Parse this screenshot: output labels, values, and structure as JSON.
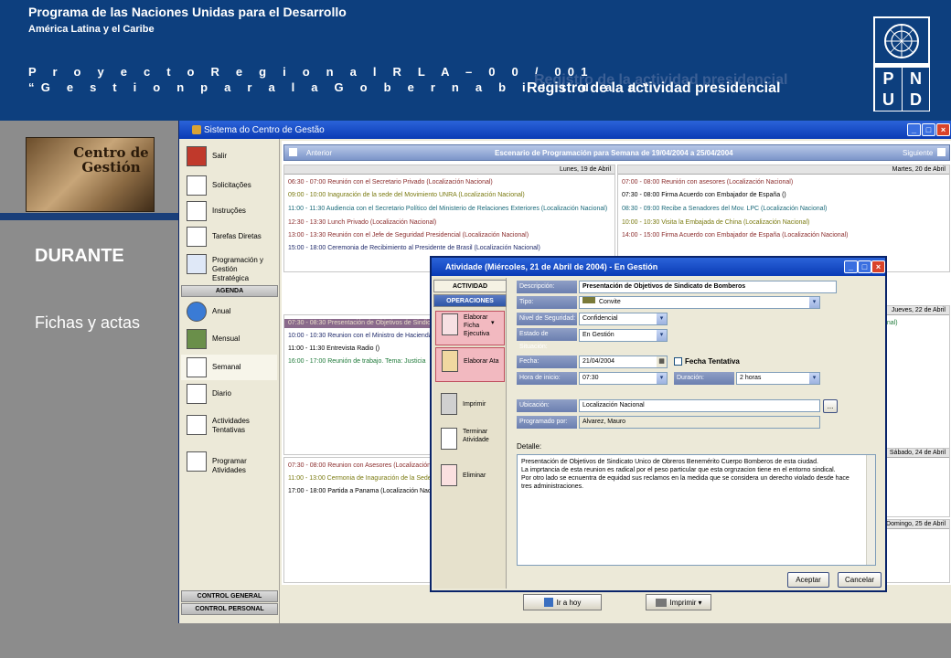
{
  "slide": {
    "org_title": "Programa de las  Naciones Unidas para el  Desarrollo",
    "org_subtitle": "América Latina y el Caribe",
    "project_line1": "P r o y e c t o   R e g i o n a l  R L A – 0 0 / 001",
    "project_line2": "“G e s t i o n   p a r a   l a   G o b e r n a b i l i d a d”",
    "title": "Registro de la actividad presidencial",
    "logo_letters": [
      "P",
      "N",
      "U",
      "D"
    ],
    "brand_image_text": "Centro de Gestión",
    "lead_word": "DURANTE",
    "lead_caption": "Fichas y actas"
  },
  "app": {
    "window_title": "Sistema do Centro de Gestão",
    "nav": {
      "items": [
        {
          "icon": "exit-door-icon",
          "label": "Salir"
        },
        {
          "icon": "clipboard-icon",
          "label": "Solicitações"
        },
        {
          "icon": "checklist-icon",
          "label": "Instruções"
        },
        {
          "icon": "notepad-icon",
          "label": "Tarefas Diretas"
        },
        {
          "icon": "strategy-screen-icon",
          "label": "Programación y Gestión Estratégica"
        }
      ],
      "agenda_header": "AGENDA",
      "agenda_items": [
        {
          "icon": "globe-icon",
          "label": "Anual"
        },
        {
          "icon": "monthly-book-icon",
          "label": "Mensual"
        },
        {
          "icon": "weekly-calendar-icon",
          "label": "Semanal"
        },
        {
          "icon": "daily-calendar-icon",
          "label": "Diario"
        },
        {
          "icon": "tentative-grid-icon",
          "label": "Actividades Tentativas"
        },
        {
          "icon": "schedule-grid-icon",
          "label": "Programar Atividades"
        }
      ],
      "footer_sections": [
        "CONTROL GENERAL",
        "CONTROL PERSONAL"
      ]
    },
    "calendar": {
      "prev_label": "Anterior",
      "next_label": "Siguiente",
      "week_title": "Escenario de Programación para Semana de 19/04/2004 a 25/04/2004",
      "monday": {
        "header": "Lunes, 19 de Abril",
        "events": [
          "06:30 - 07:00  Reunión con el Secretario Privado (Localización Nacional)",
          "09:00 - 10:00  Inaguración de la sede del  Movimiento UNRA (Localización Nacional)",
          "11:00 - 11:30  Audiencia con el Secretario Político del Ministerio de Relaciones Exteriores (Localización Nacional)",
          "12:30 - 13:30  Lunch Privado (Localización Nacional)",
          "13:00 - 13:30  Reunión con el Jefe de Seguridad Presidencial (Localización Nacional)",
          "15:00 - 18:00  Ceremonia de Recibimiento al Presidente de Brasil (Localización Nacional)"
        ]
      },
      "tuesday": {
        "header": "Martes, 20 de Abril",
        "events": [
          "07:00 - 08:00  Reunión con asesores (Localización Nacional)",
          "07:30 - 08:00  Firma Acuerdo con Embajador de España ()",
          "08:30 - 09:00  Recibe a Senadores del Mov. LPC (Localización Nacional)",
          "10:00 - 10:30  Visita la Embajada de China (Localización Nacional)",
          "14:00 - 15:00  Firma Acuerdo con Embajador de España (Localización Nacional)"
        ]
      },
      "wednesday": {
        "events": [
          "07:30 - 08:30  Presentación de Objetivos de Sindicato",
          "10:00 - 10:30  Reunion con el Ministro de Hacienda",
          "11:00 - 11:30  Entrevista Radio ()",
          "16:00 - 17:00  Reunión de trabajo. Tema: Justicia"
        ]
      },
      "thursday": {
        "header": "Jueves, 22 de Abril",
        "partial": "onal)"
      },
      "friday": {
        "events": [
          "07:30 - 08:00  Reunion con Asesores (Localización",
          "11:00 - 13:00  Cermonia de Inaguración de la Sede",
          "17:00 - 18:00  Partida a Panama (Localización Nac"
        ]
      },
      "saturday": {
        "header": "Sábado, 24 de Abril"
      },
      "sunday": {
        "header": "Domingo, 25 de Abril"
      },
      "goto_today": "Ir a hoy",
      "print": "Imprimir"
    },
    "dialog": {
      "title": "Atividade (Miércoles, 21 de Abril de 2004) - En Gestión",
      "tab_activity": "ACTIVIDAD",
      "tab_operations": "OPERACIONES",
      "ops": [
        {
          "icon": "executive-sheet-icon",
          "label": "Elaborar Ficha Ejecutiva"
        },
        {
          "icon": "minutes-icon",
          "label": "Elaborar Ata"
        },
        {
          "icon": "printer-icon",
          "label": "Imprimir"
        },
        {
          "icon": "finish-check-icon",
          "label": "Terminar Atividade"
        },
        {
          "icon": "delete-icon",
          "label": "Eliminar"
        }
      ],
      "fields": {
        "descripcion_label": "Descripción:",
        "descripcion_value": "Presentación de Objetivos de Sindicato de Bomberos",
        "tipo_label": "Tipo:",
        "tipo_value": "Convite",
        "seguridad_label": "Nivel de Seguridad:",
        "seguridad_value": "Confidencial",
        "situacion_label": "Estado de Situación:",
        "situacion_value": "En Gestión",
        "fecha_label": "Fecha:",
        "fecha_value": "21/04/2004",
        "tentativa_label": "Fecha Tentativa",
        "hora_label": "Hora de inicio:",
        "hora_value": "07:30",
        "duracion_label": "Duración:",
        "duracion_value": "2 horas",
        "ubicacion_label": "Ubicación:",
        "ubicacion_value": "Localización Nacional",
        "programado_label": "Programado por:",
        "programado_value": "Alvarez, Mauro",
        "detalle_label": "Detalle:",
        "detalle_text": "Presentación de Objetivos de Sindicato Unico de Obreros Benemérito Cuerpo Bomberos de esta ciudad.\nLa imprtancia de esta reunion es radical por el peso particular que esta orgnzacion tiene en el entorno sindical.\nPor otro lado se ecnuentra de equidad sus reclamos en la medida que se considera un derecho violado desde hace tres administraciones."
      },
      "browse_button": "...",
      "accept": "Aceptar",
      "cancel": "Cancelar"
    }
  }
}
